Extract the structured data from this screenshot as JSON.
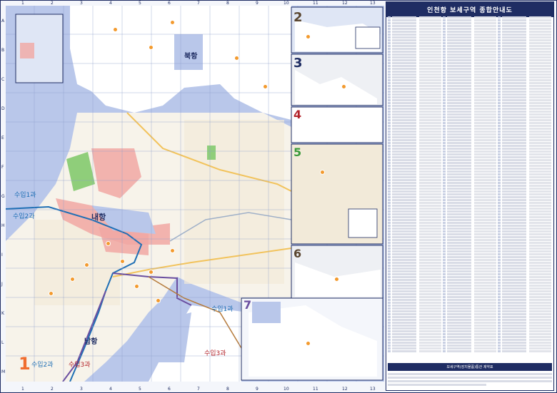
{
  "legend": {
    "title": "인천항 보세구역 종합안내도",
    "footer_heading": "보세구역(장치물품)통관 제약표"
  },
  "map": {
    "colors": {
      "sea": "#b9c7ea",
      "land": "#ffffff",
      "urban": "#f2ead9",
      "bonded": "#f1a7a3",
      "green": "#8fce7a",
      "road": "#f2c35c",
      "boundary_blue": "#1f6fb5",
      "boundary_purple": "#6b4fa0",
      "inset_border": "#1f2d63",
      "pin": "#f39a2e"
    },
    "port_labels": {
      "north_port": "북항",
      "inner_port": "내항",
      "south_port": "남항"
    },
    "division_labels": {
      "div1_top": "수입1과",
      "div2_left": "수입2과",
      "div1_right": "수입1과",
      "div2_bottom": "수입2과",
      "div3_bottom": "수입3과",
      "div3_right": "수입3과"
    },
    "zone_numbers": [
      "1",
      "2",
      "3",
      "4",
      "5",
      "6",
      "7"
    ],
    "column_labels": [
      "1",
      "2",
      "3",
      "4",
      "5",
      "6",
      "7",
      "8",
      "9",
      "10",
      "11",
      "12",
      "13"
    ],
    "row_labels": [
      "A",
      "B",
      "C",
      "D",
      "E",
      "F",
      "G",
      "H",
      "I",
      "J",
      "K",
      "L",
      "M"
    ]
  }
}
